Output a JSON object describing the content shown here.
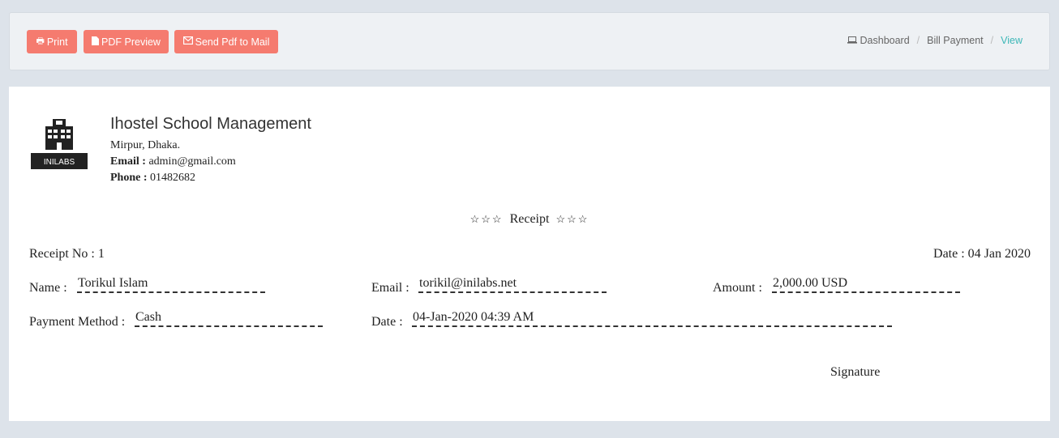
{
  "toolbar": {
    "print_label": "Print",
    "pdf_preview_label": "PDF Preview",
    "send_mail_label": "Send Pdf to Mail",
    "button_color": "#f57b6f"
  },
  "breadcrumb": {
    "dashboard": "Dashboard",
    "bill_payment": "Bill Payment",
    "view": "View",
    "active_color": "#3cb7b7"
  },
  "school": {
    "name": "Ihostel School Management",
    "address": "Mirpur, Dhaka.",
    "email_label": "Email :",
    "email": "admin@gmail.com",
    "phone_label": "Phone :",
    "phone": "01482682",
    "logo_text": "INILABS"
  },
  "receipt": {
    "stars_left": "☆☆☆",
    "title": "Receipt",
    "stars_right": "☆☆☆",
    "receipt_no": "Receipt No : 1",
    "date_header": "Date : 04 Jan 2020",
    "name_label": "Name :",
    "name": "Torikul Islam",
    "email_label": "Email :",
    "email": "torikil@inilabs.net",
    "amount_label": "Amount :",
    "amount": "2,000.00 USD",
    "payment_method_label": "Payment Method :",
    "payment_method": "Cash",
    "date_label": "Date :",
    "date": "04-Jan-2020 04:39 AM",
    "signature": "Signature"
  }
}
